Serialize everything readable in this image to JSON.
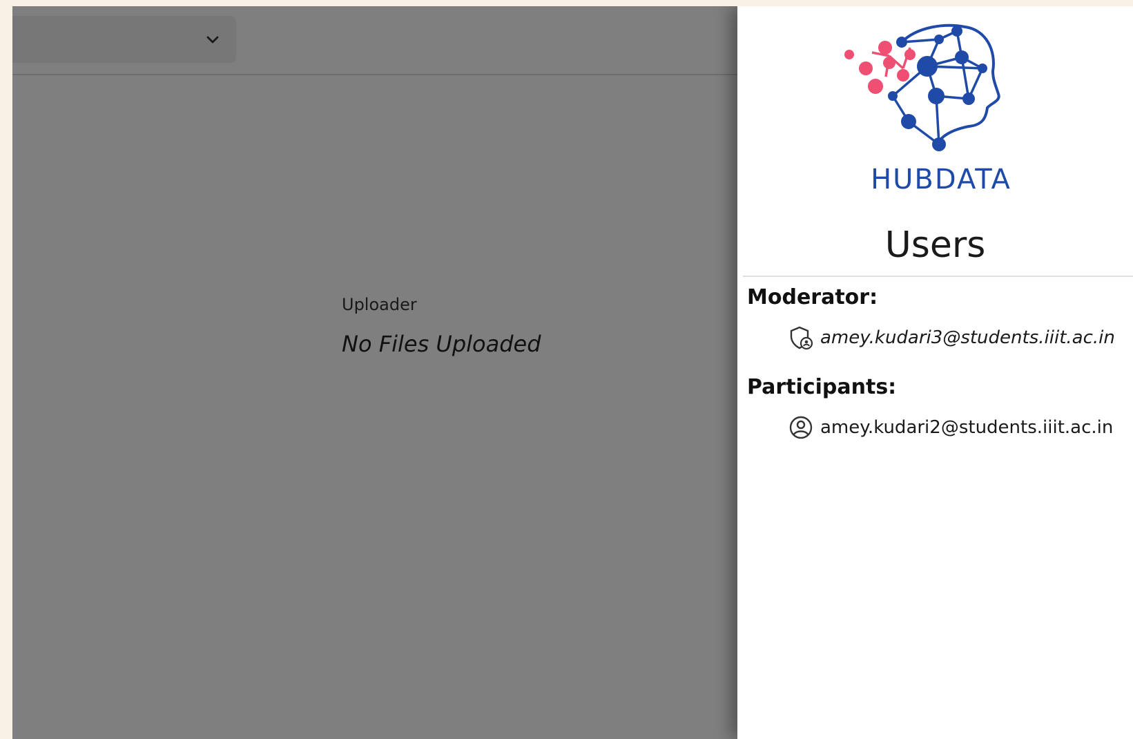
{
  "main": {
    "select": {
      "value": "",
      "icon": "chevron-down-icon"
    },
    "uploader": {
      "label": "Uploader",
      "empty_message": "No Files Uploaded"
    }
  },
  "drawer": {
    "logo": {
      "text": "HUBDATA",
      "icon": "brain-network-logo",
      "colors": {
        "pink": "#ef4f72",
        "blue": "#1f4aa8"
      }
    },
    "title": "Users",
    "moderator": {
      "heading": "Moderator:",
      "users": [
        {
          "email": "amey.kudari3@students.iiit.ac.in",
          "icon": "moderator-shield-icon"
        }
      ]
    },
    "participants": {
      "heading": "Participants:",
      "users": [
        {
          "email": "amey.kudari2@students.iiit.ac.in",
          "icon": "user-circle-icon"
        }
      ]
    }
  }
}
